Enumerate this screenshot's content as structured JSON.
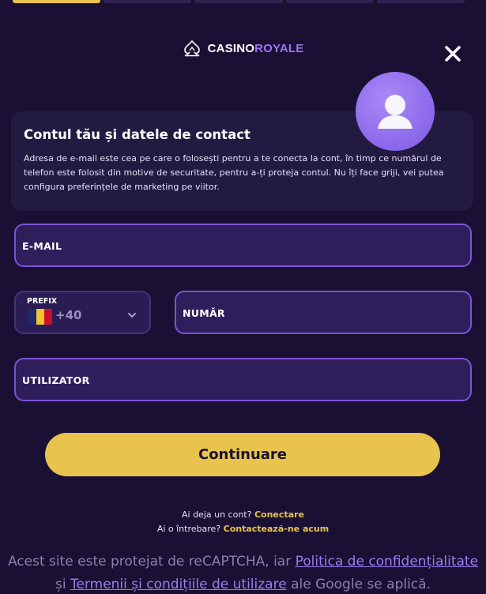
{
  "steps": [
    {
      "active": true
    },
    {
      "active": false
    },
    {
      "active": false
    },
    {
      "active": false
    },
    {
      "active": false
    }
  ],
  "logo": {
    "casino": "CASINO",
    "royale": "ROYALE"
  },
  "icons": {
    "close": "close-icon",
    "avatar": "user-avatar-icon",
    "logo": "spade-crown-logo-icon",
    "chevron": "chevron-down-icon",
    "flag": "romania-flag-icon"
  },
  "info": {
    "title": "Contul tău și datele de contact",
    "text": "Adresa de e-mail este cea pe care o folosești pentru a te conecta la cont, în timp ce numărul de telefon este folosit din motive de securitate, pentru a-ți proteja contul. Nu îți face griji, vei putea configura preferințele de marketing pe viitor."
  },
  "form": {
    "email_label": "E-MAIL",
    "prefix_label": "PREFIX",
    "prefix_value": "+40",
    "number_label": "NUMĂR",
    "username_label": "UTILIZATOR"
  },
  "colors": {
    "accent": "#e8c44f",
    "purple": "#7c52d6",
    "background": "#1a1033",
    "flag": [
      "#1a2a6c",
      "#f4c430",
      "#c8102e"
    ]
  },
  "continue_label": "Continuare",
  "help": {
    "have_account": "Ai deja un cont?",
    "login_link": "Conectare",
    "question": "Ai o întrebare?",
    "contact_link": "Contactează-ne acum"
  },
  "captcha": {
    "prefix": "Acest site este protejat de reCAPTCHA, iar ",
    "privacy_link": "Politica de confidențialitate",
    "and": "și ",
    "terms_link": "Termenii și condițiile de utilizare",
    "suffix": " ale Google se aplică."
  }
}
